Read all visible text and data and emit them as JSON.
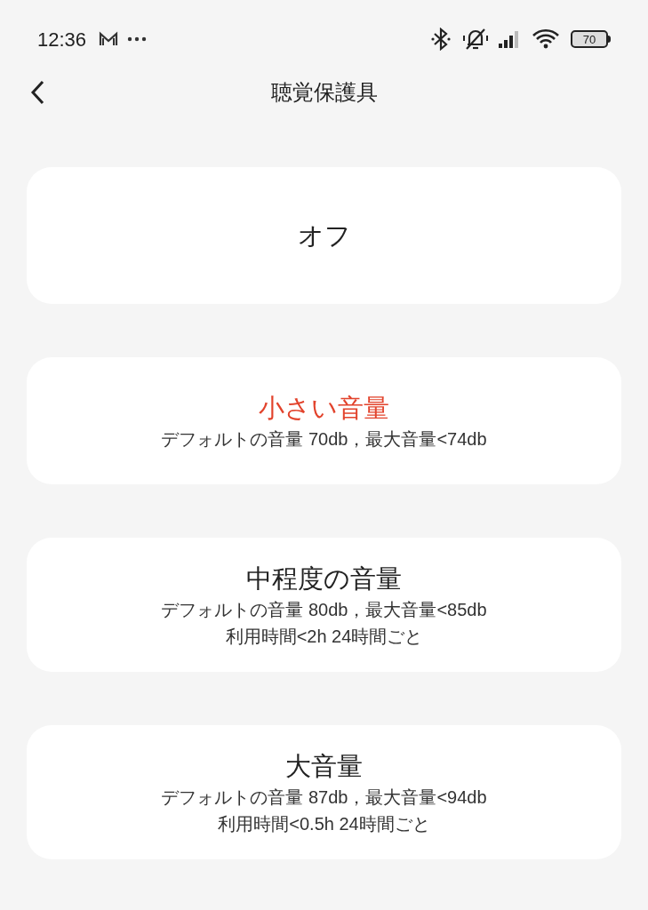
{
  "status_bar": {
    "time": "12:36",
    "battery": "70"
  },
  "header": {
    "title": "聴覚保護具"
  },
  "options": [
    {
      "title": "オフ",
      "selected": false
    },
    {
      "title": "小さい音量",
      "selected": true,
      "lines": [
        "デフォルトの音量 70db，最大音量<74db"
      ]
    },
    {
      "title": "中程度の音量",
      "selected": false,
      "lines": [
        "デフォルトの音量 80db，最大音量<85db",
        "利用時間<2h 24時間ごと"
      ]
    },
    {
      "title": "大音量",
      "selected": false,
      "lines": [
        "デフォルトの音量 87db，最大音量<94db",
        "利用時間<0.5h 24時間ごと"
      ]
    }
  ]
}
